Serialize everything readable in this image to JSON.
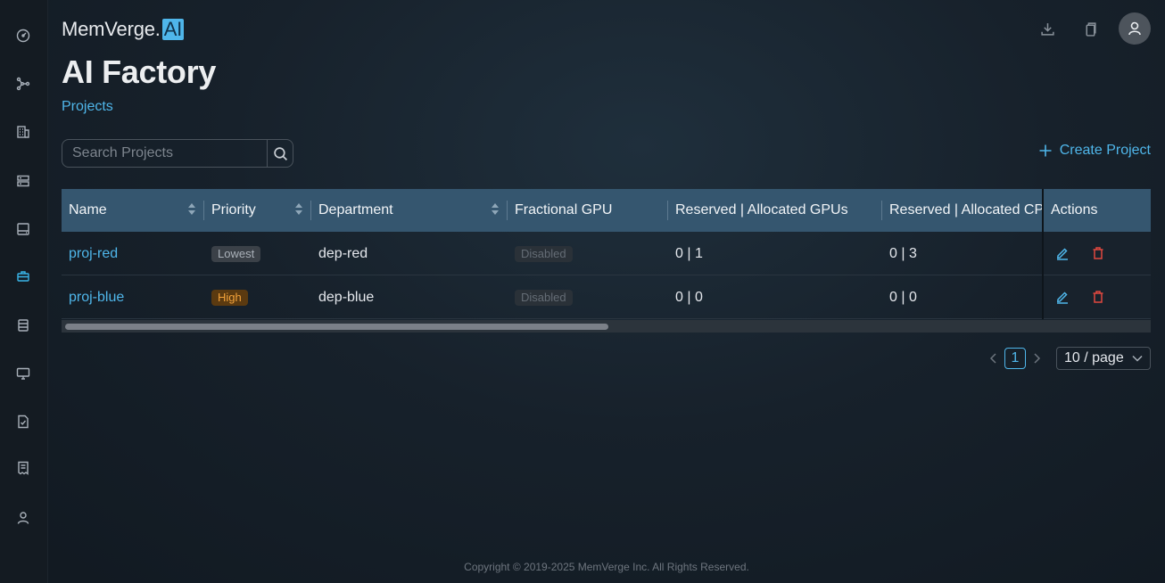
{
  "brand": {
    "name": "MemVerge.",
    "ai_badge": "AI"
  },
  "page": {
    "title": "AI Factory",
    "breadcrumb": "Projects"
  },
  "sidebar": {
    "items": [
      {
        "icon": "dashboard-gauge-icon"
      },
      {
        "icon": "cluster-nodes-icon"
      },
      {
        "icon": "building-icon"
      },
      {
        "icon": "server-icon"
      },
      {
        "icon": "storage-icon"
      },
      {
        "icon": "projects-briefcase-icon",
        "active": true
      },
      {
        "icon": "database-icon"
      },
      {
        "icon": "desktop-icon"
      },
      {
        "icon": "checklist-icon"
      },
      {
        "icon": "receipt-icon"
      },
      {
        "icon": "user-icon"
      }
    ]
  },
  "header_actions": [
    "download-icon",
    "copy-icon",
    "avatar-icon"
  ],
  "search": {
    "placeholder": "Search Projects"
  },
  "create_button": {
    "label": "Create Project"
  },
  "table": {
    "columns": [
      "Name",
      "Priority",
      "Department",
      "Fractional GPU",
      "Reserved | Allocated GPUs",
      "Reserved | Allocated CPUs",
      "Actions"
    ],
    "rows": [
      {
        "name": "proj-red",
        "priority": "Lowest",
        "department": "dep-red",
        "fractional_gpu": "Disabled",
        "gpus": "0 | 1",
        "cpus": "0 | 3"
      },
      {
        "name": "proj-blue",
        "priority": "High",
        "department": "dep-blue",
        "fractional_gpu": "Disabled",
        "gpus": "0 | 0",
        "cpus": "0 | 0"
      }
    ]
  },
  "pagination": {
    "current_page": "1",
    "page_size": "10 / page"
  },
  "footer": {
    "copyright": "Copyright © 2019-2025 MemVerge Inc. All Rights Reserved."
  },
  "colors": {
    "accent": "#4fb6ea",
    "table_header": "#35566f",
    "danger": "#e0483f",
    "priority_high": "#f3a23a"
  }
}
